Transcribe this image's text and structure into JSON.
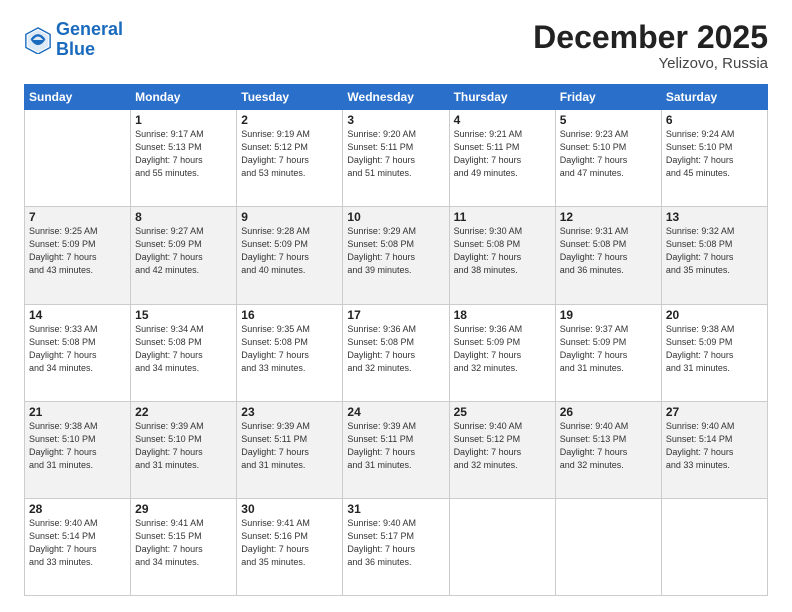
{
  "header": {
    "logo_line1": "General",
    "logo_line2": "Blue",
    "month": "December 2025",
    "location": "Yelizovo, Russia"
  },
  "weekdays": [
    "Sunday",
    "Monday",
    "Tuesday",
    "Wednesday",
    "Thursday",
    "Friday",
    "Saturday"
  ],
  "weeks": [
    [
      {
        "day": "",
        "info": ""
      },
      {
        "day": "1",
        "info": "Sunrise: 9:17 AM\nSunset: 5:13 PM\nDaylight: 7 hours\nand 55 minutes."
      },
      {
        "day": "2",
        "info": "Sunrise: 9:19 AM\nSunset: 5:12 PM\nDaylight: 7 hours\nand 53 minutes."
      },
      {
        "day": "3",
        "info": "Sunrise: 9:20 AM\nSunset: 5:11 PM\nDaylight: 7 hours\nand 51 minutes."
      },
      {
        "day": "4",
        "info": "Sunrise: 9:21 AM\nSunset: 5:11 PM\nDaylight: 7 hours\nand 49 minutes."
      },
      {
        "day": "5",
        "info": "Sunrise: 9:23 AM\nSunset: 5:10 PM\nDaylight: 7 hours\nand 47 minutes."
      },
      {
        "day": "6",
        "info": "Sunrise: 9:24 AM\nSunset: 5:10 PM\nDaylight: 7 hours\nand 45 minutes."
      }
    ],
    [
      {
        "day": "7",
        "info": "Sunrise: 9:25 AM\nSunset: 5:09 PM\nDaylight: 7 hours\nand 43 minutes."
      },
      {
        "day": "8",
        "info": "Sunrise: 9:27 AM\nSunset: 5:09 PM\nDaylight: 7 hours\nand 42 minutes."
      },
      {
        "day": "9",
        "info": "Sunrise: 9:28 AM\nSunset: 5:09 PM\nDaylight: 7 hours\nand 40 minutes."
      },
      {
        "day": "10",
        "info": "Sunrise: 9:29 AM\nSunset: 5:08 PM\nDaylight: 7 hours\nand 39 minutes."
      },
      {
        "day": "11",
        "info": "Sunrise: 9:30 AM\nSunset: 5:08 PM\nDaylight: 7 hours\nand 38 minutes."
      },
      {
        "day": "12",
        "info": "Sunrise: 9:31 AM\nSunset: 5:08 PM\nDaylight: 7 hours\nand 36 minutes."
      },
      {
        "day": "13",
        "info": "Sunrise: 9:32 AM\nSunset: 5:08 PM\nDaylight: 7 hours\nand 35 minutes."
      }
    ],
    [
      {
        "day": "14",
        "info": "Sunrise: 9:33 AM\nSunset: 5:08 PM\nDaylight: 7 hours\nand 34 minutes."
      },
      {
        "day": "15",
        "info": "Sunrise: 9:34 AM\nSunset: 5:08 PM\nDaylight: 7 hours\nand 34 minutes."
      },
      {
        "day": "16",
        "info": "Sunrise: 9:35 AM\nSunset: 5:08 PM\nDaylight: 7 hours\nand 33 minutes."
      },
      {
        "day": "17",
        "info": "Sunrise: 9:36 AM\nSunset: 5:08 PM\nDaylight: 7 hours\nand 32 minutes."
      },
      {
        "day": "18",
        "info": "Sunrise: 9:36 AM\nSunset: 5:09 PM\nDaylight: 7 hours\nand 32 minutes."
      },
      {
        "day": "19",
        "info": "Sunrise: 9:37 AM\nSunset: 5:09 PM\nDaylight: 7 hours\nand 31 minutes."
      },
      {
        "day": "20",
        "info": "Sunrise: 9:38 AM\nSunset: 5:09 PM\nDaylight: 7 hours\nand 31 minutes."
      }
    ],
    [
      {
        "day": "21",
        "info": "Sunrise: 9:38 AM\nSunset: 5:10 PM\nDaylight: 7 hours\nand 31 minutes."
      },
      {
        "day": "22",
        "info": "Sunrise: 9:39 AM\nSunset: 5:10 PM\nDaylight: 7 hours\nand 31 minutes."
      },
      {
        "day": "23",
        "info": "Sunrise: 9:39 AM\nSunset: 5:11 PM\nDaylight: 7 hours\nand 31 minutes."
      },
      {
        "day": "24",
        "info": "Sunrise: 9:39 AM\nSunset: 5:11 PM\nDaylight: 7 hours\nand 31 minutes."
      },
      {
        "day": "25",
        "info": "Sunrise: 9:40 AM\nSunset: 5:12 PM\nDaylight: 7 hours\nand 32 minutes."
      },
      {
        "day": "26",
        "info": "Sunrise: 9:40 AM\nSunset: 5:13 PM\nDaylight: 7 hours\nand 32 minutes."
      },
      {
        "day": "27",
        "info": "Sunrise: 9:40 AM\nSunset: 5:14 PM\nDaylight: 7 hours\nand 33 minutes."
      }
    ],
    [
      {
        "day": "28",
        "info": "Sunrise: 9:40 AM\nSunset: 5:14 PM\nDaylight: 7 hours\nand 33 minutes."
      },
      {
        "day": "29",
        "info": "Sunrise: 9:41 AM\nSunset: 5:15 PM\nDaylight: 7 hours\nand 34 minutes."
      },
      {
        "day": "30",
        "info": "Sunrise: 9:41 AM\nSunset: 5:16 PM\nDaylight: 7 hours\nand 35 minutes."
      },
      {
        "day": "31",
        "info": "Sunrise: 9:40 AM\nSunset: 5:17 PM\nDaylight: 7 hours\nand 36 minutes."
      },
      {
        "day": "",
        "info": ""
      },
      {
        "day": "",
        "info": ""
      },
      {
        "day": "",
        "info": ""
      }
    ]
  ]
}
